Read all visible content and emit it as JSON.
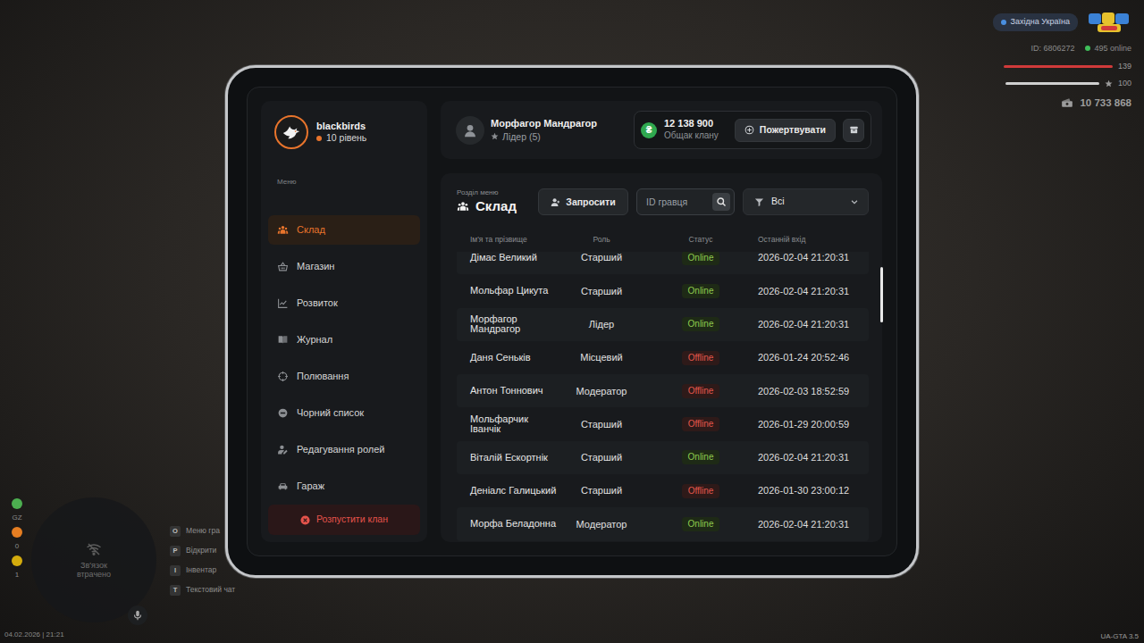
{
  "hud": {
    "region": "Західна Україна",
    "player_id": "ID: 6806272",
    "online": "495 online",
    "health": {
      "value": "139",
      "level": 1
    },
    "armor": {
      "value": "100",
      "level": 1
    },
    "money": "10 733 868",
    "indicators": [
      {
        "label": "GZ",
        "color": "#4caf50"
      },
      {
        "label": "0",
        "color": "#e67e22"
      },
      {
        "label": "1",
        "color": "#d4ac0d"
      }
    ],
    "minimap": {
      "message": "Зв'язок втрачено"
    },
    "key_hints": [
      {
        "key": "O",
        "label": "Меню гра"
      },
      {
        "key": "P",
        "label": "Відкрити"
      },
      {
        "key": "I",
        "label": "Інвентар"
      },
      {
        "key": "T",
        "label": "Текстовий чат"
      }
    ],
    "datetime": "04.02.2026 | 21:21",
    "version": "UA-GTA 3.5"
  },
  "clan": {
    "name": "blackbirds",
    "level": "10 рівень"
  },
  "sidebar": {
    "menu_label": "Меню",
    "items": [
      {
        "label": "Склад",
        "selected": true
      },
      {
        "label": "Магазин",
        "selected": false
      },
      {
        "label": "Розвиток",
        "selected": false
      },
      {
        "label": "Журнал",
        "selected": false
      },
      {
        "label": "Полювання",
        "selected": false
      },
      {
        "label": "Чорний список",
        "selected": false
      },
      {
        "label": "Редагування ролей",
        "selected": false
      },
      {
        "label": "Гараж",
        "selected": false
      }
    ],
    "disband_button": "Розпустити клан"
  },
  "header": {
    "player_name": "Морфагор Мандрагор",
    "player_rank": "Лідер (5)",
    "currency_icon": "₴",
    "bank_amount": "12 138 900",
    "bank_label": "Общак клану",
    "donate_button": "Пожертвувати"
  },
  "section": {
    "caption": "Розділ меню",
    "title": "Склад",
    "invite_button": "Запросити",
    "search": {
      "placeholder": "ID гравця"
    },
    "filter": {
      "value": "Всі"
    }
  },
  "table": {
    "columns": [
      "Ім'я та прізвище",
      "Роль",
      "Статус",
      "Останній вхід"
    ],
    "rows": [
      {
        "name": "Дімас Великий",
        "role": "Старший",
        "status": "Online",
        "online": true,
        "last_login": "2026-02-04 21:20:31"
      },
      {
        "name": "Мольфар Цикута",
        "role": "Старший",
        "status": "Online",
        "online": true,
        "last_login": "2026-02-04 21:20:31"
      },
      {
        "name": "Морфагор Мандрагор",
        "role": "Лідер",
        "status": "Online",
        "online": true,
        "last_login": "2026-02-04 21:20:31"
      },
      {
        "name": "Даня Сеньків",
        "role": "Місцевий",
        "status": "Offline",
        "online": false,
        "last_login": "2026-01-24 20:52:46"
      },
      {
        "name": "Антон Тоннович",
        "role": "Модератор",
        "status": "Offline",
        "online": false,
        "last_login": "2026-02-03 18:52:59"
      },
      {
        "name": "Мольфарчик Іванчік",
        "role": "Старший",
        "status": "Offline",
        "online": false,
        "last_login": "2026-01-29 20:00:59"
      },
      {
        "name": "Віталій Ескортнік",
        "role": "Старший",
        "status": "Online",
        "online": true,
        "last_login": "2026-02-04 21:20:31"
      },
      {
        "name": "Деніалс Галицький",
        "role": "Старший",
        "status": "Offline",
        "online": false,
        "last_login": "2026-01-30 23:00:12"
      },
      {
        "name": "Морфа Беладонна",
        "role": "Модератор",
        "status": "Online",
        "online": true,
        "last_login": "2026-02-04 21:20:31"
      }
    ]
  }
}
